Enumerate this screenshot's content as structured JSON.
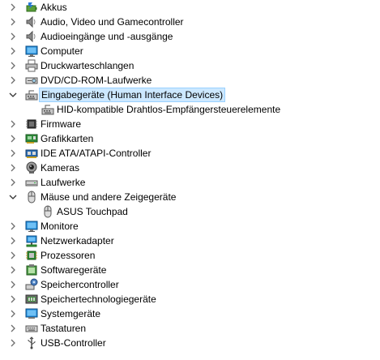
{
  "tree": [
    {
      "label": "Akkus",
      "expanded": false,
      "icon": "battery-icon"
    },
    {
      "label": "Audio, Video und Gamecontroller",
      "expanded": false,
      "icon": "speaker-icon"
    },
    {
      "label": "Audioeingänge und -ausgänge",
      "expanded": false,
      "icon": "speaker-icon"
    },
    {
      "label": "Computer",
      "expanded": false,
      "icon": "monitor-icon"
    },
    {
      "label": "Druckwarteschlangen",
      "expanded": false,
      "icon": "printer-icon"
    },
    {
      "label": "DVD/CD-ROM-Laufwerke",
      "expanded": false,
      "icon": "optical-drive-icon"
    },
    {
      "label": "Eingabegeräte (Human Interface Devices)",
      "expanded": true,
      "selected": true,
      "icon": "hid-icon",
      "children": [
        {
          "label": "HID-kompatible Drahtlos-Empfängersteuerelemente",
          "icon": "hid-icon"
        }
      ]
    },
    {
      "label": "Firmware",
      "expanded": false,
      "icon": "chip-icon"
    },
    {
      "label": "Grafikkarten",
      "expanded": false,
      "icon": "display-adapter-icon"
    },
    {
      "label": "IDE ATA/ATAPI-Controller",
      "expanded": false,
      "icon": "ide-controller-icon"
    },
    {
      "label": "Kameras",
      "expanded": false,
      "icon": "camera-icon"
    },
    {
      "label": "Laufwerke",
      "expanded": false,
      "icon": "disk-drive-icon"
    },
    {
      "label": "Mäuse und andere Zeigegeräte",
      "expanded": true,
      "icon": "mouse-icon",
      "children": [
        {
          "label": "ASUS Touchpad",
          "icon": "mouse-icon"
        }
      ]
    },
    {
      "label": "Monitore",
      "expanded": false,
      "icon": "monitor-icon"
    },
    {
      "label": "Netzwerkadapter",
      "expanded": false,
      "icon": "network-icon"
    },
    {
      "label": "Prozessoren",
      "expanded": false,
      "icon": "processor-icon"
    },
    {
      "label": "Softwaregeräte",
      "expanded": false,
      "icon": "software-device-icon"
    },
    {
      "label": "Speichercontroller",
      "expanded": false,
      "icon": "storage-controller-icon"
    },
    {
      "label": "Speichertechnologiegeräte",
      "expanded": false,
      "icon": "memory-technology-icon"
    },
    {
      "label": "Systemgeräte",
      "expanded": false,
      "icon": "system-device-icon"
    },
    {
      "label": "Tastaturen",
      "expanded": false,
      "icon": "keyboard-icon"
    },
    {
      "label": "USB-Controller",
      "expanded": false,
      "icon": "usb-icon"
    }
  ],
  "colors": {
    "selection_bg": "#cce8ff",
    "selection_border": "#99d1ff",
    "chevron": "#6d6d6d"
  }
}
